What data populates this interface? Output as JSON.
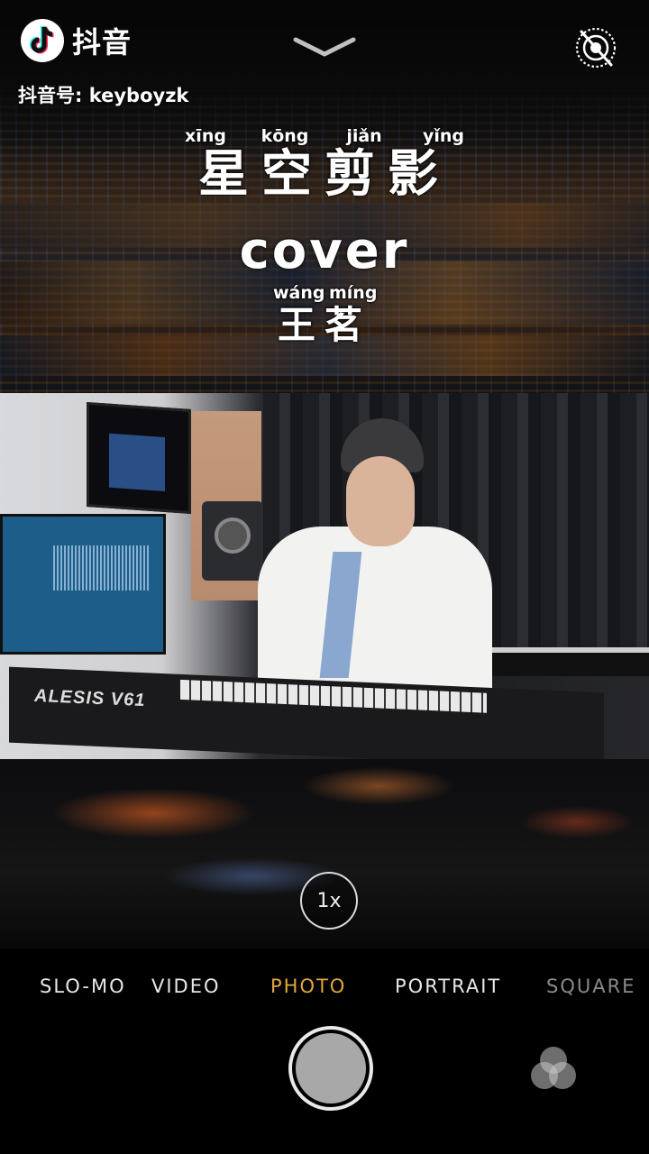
{
  "app": {
    "name": "抖音",
    "account": "抖音号: keyboyzk"
  },
  "song": {
    "title_pinyin": [
      "xīng",
      "kōng",
      "jiǎn",
      "yǐng"
    ],
    "title_hanzi": "星空剪影",
    "subtitle": "cover",
    "artist_pinyin": [
      "wáng",
      "míng"
    ],
    "artist_hanzi": "王茗"
  },
  "photo": {
    "keyboard_brand": "ALESIS V61"
  },
  "camera": {
    "zoom": "1x",
    "modes": [
      "SLO-MO",
      "VIDEO",
      "PHOTO",
      "PORTRAIT",
      "SQUARE"
    ],
    "active_mode": "PHOTO"
  },
  "icons": {
    "top_center": "chevron-down-icon",
    "top_right": "live-photo-off-icon",
    "bottom_right": "filters-icon"
  },
  "colors": {
    "accent": "#e0a73d",
    "tiktok_cyan": "#25f4ee",
    "tiktok_red": "#fe2c55"
  }
}
